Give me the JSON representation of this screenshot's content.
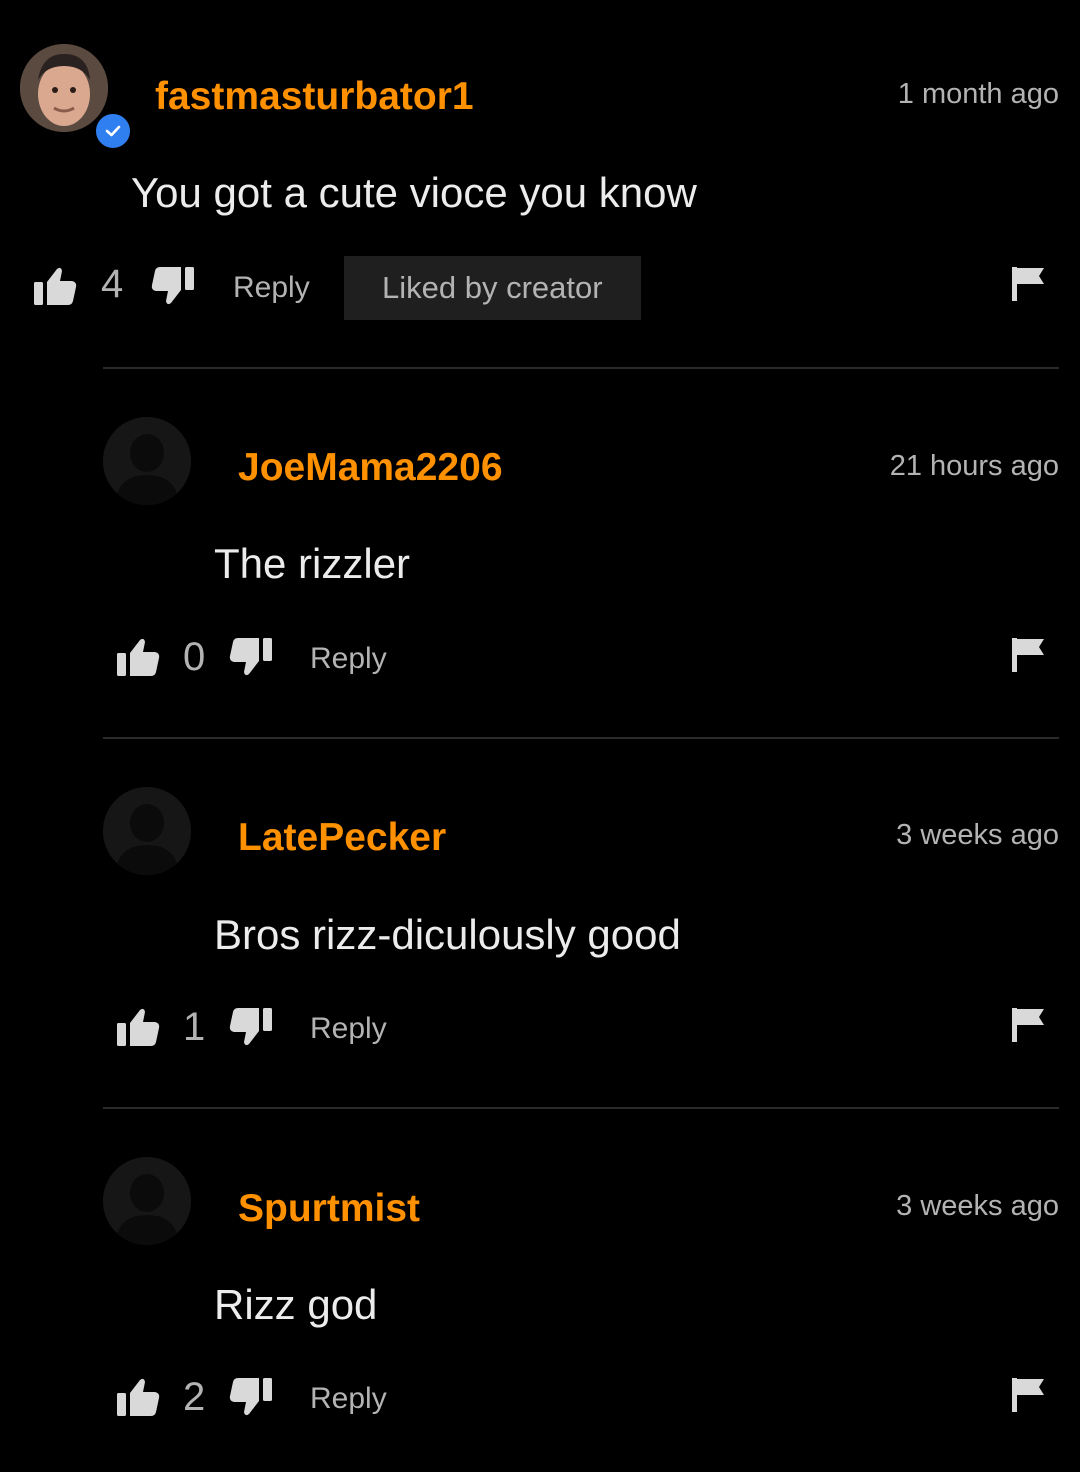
{
  "comments": [
    {
      "username": "fastmasturbator1",
      "time": "1 month ago",
      "text": "You got a cute vioce you know",
      "likes": "4",
      "reply_label": "Reply",
      "badge": "Liked by creator",
      "verified": true
    },
    {
      "username": "JoeMama2206",
      "time": "21 hours ago",
      "text": "The rizzler",
      "likes": "0",
      "reply_label": "Reply"
    },
    {
      "username": "LatePecker",
      "time": "3 weeks ago",
      "text": "Bros rizz-diculously good",
      "likes": "1",
      "reply_label": "Reply"
    },
    {
      "username": "Spurtmist",
      "time": "3 weeks ago",
      "text": "Rizz god",
      "likes": "2",
      "reply_label": "Reply"
    }
  ],
  "icons": {
    "like": "thumbs-up-icon",
    "dislike": "thumbs-down-icon",
    "flag": "flag-icon",
    "verified": "verified-check-icon"
  },
  "colors": {
    "background": "#000000",
    "username": "#ff9000",
    "muted": "#b3b3b3",
    "badge_bg": "#1f1f1f",
    "verified": "#2f7ff0"
  }
}
